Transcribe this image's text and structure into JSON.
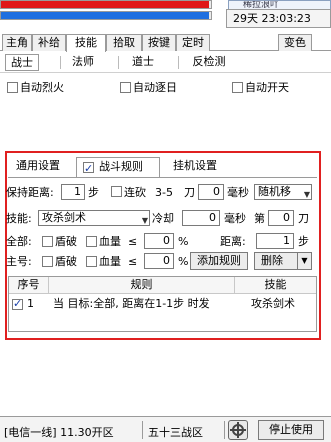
{
  "bars": {
    "hp_color": "#e01818",
    "mp_color": "#1f6fe0",
    "hp_fraction": 0.99,
    "mp_fraction": 0.99
  },
  "header": {
    "title_partial": "稀拉浪吖",
    "time_text": "29天 23:03:23"
  },
  "main_tabs": [
    "主角",
    "补给",
    "技能",
    "拾取",
    "按键",
    "定时",
    "变色"
  ],
  "sub_tabs": [
    "战士",
    "法师",
    "道士",
    "反检测"
  ],
  "auto_options": [
    "自动烈火",
    "自动逐日",
    "自动开天"
  ],
  "settings_tabs": [
    "通用设置",
    "战斗规则",
    "挂机设置"
  ],
  "row_distance": {
    "label": "保持距离:",
    "value": "1",
    "unit": "步",
    "chain_label": "连砍",
    "range": "3-5",
    "blade_unit": "刀",
    "ms_value": "0",
    "ms_label": "毫秒",
    "move_option": "随机移"
  },
  "row_skill": {
    "label": "技能:",
    "skill": "攻杀剑术",
    "cooldown_label": "冷却",
    "cooldown_value": "0",
    "ms_label": "毫秒",
    "nth_label": "第",
    "nth_value": "0",
    "blade_unit": "刀"
  },
  "row_all": {
    "label": "全部:",
    "shield_label": "盾破",
    "hp_label": "血量",
    "cmp": "≤",
    "hp_value": "0",
    "percent": "%",
    "distance_label": "距离:",
    "distance_value": "1",
    "distance_unit": "步"
  },
  "row_main": {
    "label": "主号:",
    "shield_label": "盾破",
    "hp_label": "血量",
    "cmp": "≤",
    "hp_value": "0",
    "percent": "%",
    "add_button": "添加规则",
    "delete_button": "删除"
  },
  "rule_list": {
    "headers": [
      "序号",
      "规则",
      "技能"
    ],
    "rows": [
      {
        "index": "1",
        "rule": "当 目标:全部, 距离在1-1步 时发",
        "skill": "攻杀剑术",
        "checked": true
      }
    ]
  },
  "status": {
    "server_text": "[电信一线] 11.30开区",
    "zone_text": "五十三战区",
    "stop_button": "停止使用"
  }
}
